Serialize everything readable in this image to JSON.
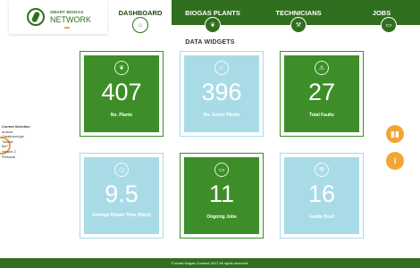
{
  "brand": {
    "line1": "SMART BIOGAS",
    "line2": "NETWORK"
  },
  "nav": [
    {
      "label": "DASHBOARD",
      "active": true,
      "icon": "home-icon"
    },
    {
      "label": "BIOGAS PLANTS",
      "active": false,
      "icon": "leaf-icon"
    },
    {
      "label": "TECHNICIANS",
      "active": false,
      "icon": "wrench-icon"
    },
    {
      "label": "JOBS",
      "active": false,
      "icon": "briefcase-icon"
    }
  ],
  "section_title": "DATA WIDGETS",
  "selection": {
    "title": "Current Selection",
    "items": [
      "Arusha",
      "Creativenergie",
      "Tubular",
      "6m³",
      "Version 2",
      "Personal"
    ]
  },
  "widgets": [
    {
      "value": "407",
      "label": "No. Plants",
      "color": "#3d8e28",
      "icon": "leaf-icon"
    },
    {
      "value": "396",
      "label": "No. Active Plants",
      "color": "#a9dbe7",
      "icon": "check-icon"
    },
    {
      "value": "27",
      "label": "Total Faults",
      "color": "#3d8e28",
      "icon": "warning-icon"
    },
    {
      "value": "9.5",
      "label": "Average Repair Time (Days)",
      "color": "#a9dbe7",
      "icon": "clock-icon"
    },
    {
      "value": "11",
      "label": "Ongoing Jobs",
      "color": "#3d8e28",
      "icon": "briefcase-icon"
    },
    {
      "value": "16",
      "label": "Faults fixed",
      "color": "#a9dbe7",
      "icon": "wrench-icon"
    }
  ],
  "right_buttons": [
    {
      "icon": "bar-chart-icon"
    },
    {
      "icon": "info-icon"
    }
  ],
  "footer": "© smart biogas Connect 2017 All rights reserved.",
  "colors": {
    "primary": "#2f6f1f",
    "accent": "#f2a535",
    "widget_green": "#3d8e28",
    "widget_blue": "#a9dbe7"
  }
}
